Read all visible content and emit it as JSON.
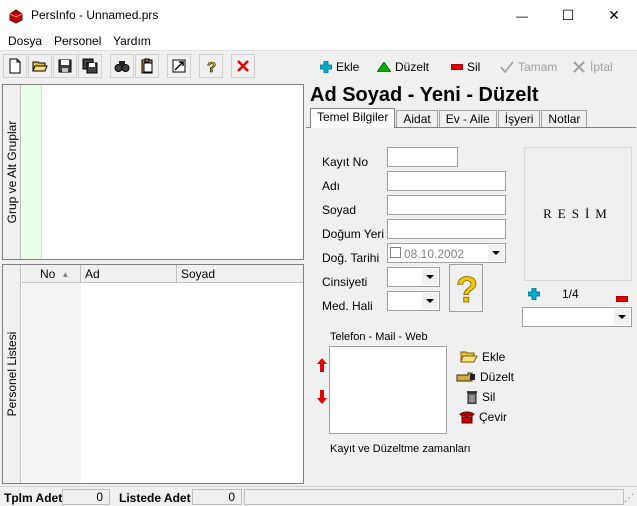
{
  "window": {
    "title": "PersInfo - Unnamed.prs",
    "min_glyph": "—",
    "max_glyph": "☐",
    "close_glyph": "✕"
  },
  "menu": [
    "Dosya",
    "Personel",
    "Yardım"
  ],
  "toolbar": {
    "icons": [
      "new-file-icon",
      "open-folder-icon",
      "save-icon",
      "save-as-icon",
      "find-icon",
      "clipboard-icon",
      "export-icon",
      "help-icon",
      "close-red-x-icon"
    ]
  },
  "actions": {
    "add": "Ekle",
    "edit": "Düzelt",
    "delete": "Sil",
    "ok": "Tamam",
    "cancel": "İptal"
  },
  "panes": {
    "groups_label": "Grup ve Alt Gruplar",
    "personnel_label": "Personel Listesi"
  },
  "list": {
    "columns": [
      "No",
      "Ad",
      "Soyad"
    ],
    "sort_glyph": "▲"
  },
  "form": {
    "title": "Ad Soyad - Yeni - Düzelt",
    "tabs": [
      "Temel Bilgiler",
      "Aidat",
      "Ev - Aile",
      "İşyeri",
      "Notlar"
    ],
    "active_tab": "Temel Bilgiler",
    "labels": {
      "record_no": "Kayıt No",
      "first_name": "Adı",
      "last_name": "Soyad",
      "birth_place": "Doğum Yeri",
      "birth_date": "Doğ. Tarihi",
      "gender": "Cinsiyeti",
      "marital": "Med. Hali"
    },
    "values": {
      "record_no": "",
      "first_name": "",
      "last_name": "",
      "birth_place": "",
      "birth_date": "08.10.2002",
      "gender": "",
      "marital": ""
    },
    "photo_label": "RESİM",
    "photo_counter": "1/4",
    "contact_label": "Telefon - Mail - Web",
    "contact_actions": {
      "add": "Ekle",
      "edit": "Düzelt",
      "delete": "Sil",
      "dial": "Çevir"
    },
    "timestamps_label": "Kayıt ve Düzeltme zamanları"
  },
  "status": {
    "total_label": "Tplm Adet",
    "total_value": "0",
    "listed_label": "Listede Adet",
    "listed_value": "0"
  },
  "colors": {
    "group_strip": "#e6ffe6",
    "add_icon": "#00a0c0",
    "edit_icon": "#00a000",
    "delete_icon": "#e00000"
  }
}
